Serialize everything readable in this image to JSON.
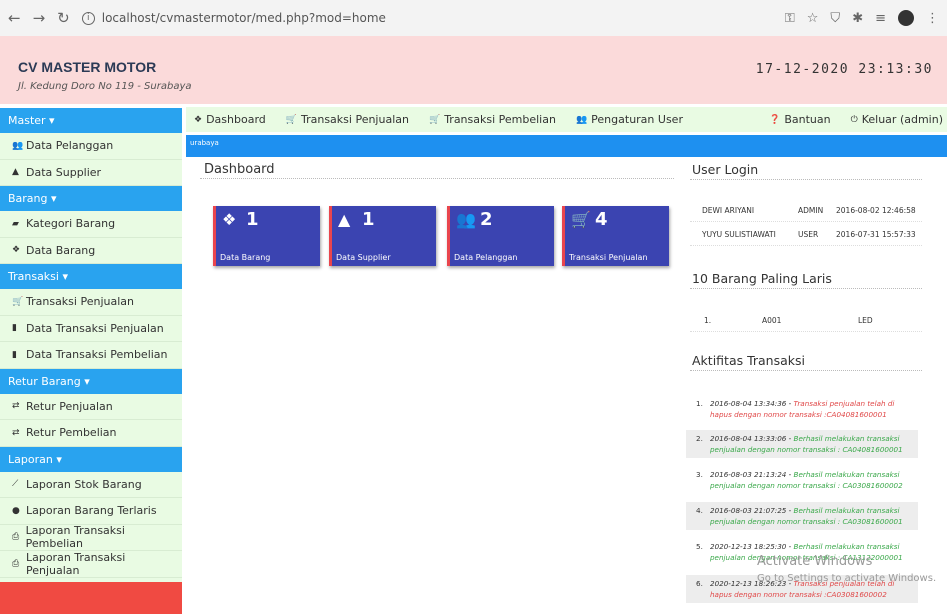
{
  "browser": {
    "url": "localhost/cvmastermotor/med.php?mod=home"
  },
  "header": {
    "brand_name": "CV MASTER MOTOR",
    "brand_address": "Jl. Kedung Doro No 119 - Surabaya",
    "datetime": "17-12-2020 23:13:30"
  },
  "sidebar": {
    "sections": [
      {
        "title": "Master ▾",
        "items": [
          {
            "label": "Data Pelanggan",
            "icon": "users-icon"
          },
          {
            "label": "Data Supplier",
            "icon": "user-icon"
          }
        ]
      },
      {
        "title": "Barang ▾",
        "items": [
          {
            "label": "Kategori Barang",
            "icon": "folder-icon"
          },
          {
            "label": "Data Barang",
            "icon": "cubes-icon"
          }
        ]
      },
      {
        "title": "Transaksi ▾",
        "items": [
          {
            "label": "Transaksi Penjualan",
            "icon": "cart-icon"
          },
          {
            "label": "Data Transaksi Penjualan",
            "icon": "book-icon"
          },
          {
            "label": "Data Transaksi Pembelian",
            "icon": "book-icon"
          }
        ]
      },
      {
        "title": "Retur Barang ▾",
        "items": [
          {
            "label": "Retur Penjualan",
            "icon": "return-cart-icon"
          },
          {
            "label": "Retur Pembelian",
            "icon": "return-cart-icon"
          }
        ]
      },
      {
        "title": "Laporan ▾",
        "items": [
          {
            "label": "Laporan Stok Barang",
            "icon": "chart-icon"
          },
          {
            "label": "Laporan Barang Terlaris",
            "icon": "star-icon"
          },
          {
            "label": "Laporan Transaksi Pembelian",
            "icon": "print-icon"
          },
          {
            "label": "Laporan Transaksi Penjualan",
            "icon": "print-icon"
          }
        ]
      }
    ]
  },
  "topmenu": {
    "dashboard": "Dashboard",
    "transaksi_penjualan": "Transaksi Penjualan",
    "transaksi_pembelian": "Transaksi Pembelian",
    "pengaturan_user": "Pengaturan User",
    "bantuan": "Bantuan",
    "keluar": "Keluar (admin)"
  },
  "breadcrumb": "urabaya",
  "main": {
    "title": "Dashboard",
    "boxes": [
      {
        "count": "1",
        "label": "Data Barang",
        "icon": "cubes-icon"
      },
      {
        "count": "1",
        "label": "Data Supplier",
        "icon": "user-icon"
      },
      {
        "count": "2",
        "label": "Data Pelanggan",
        "icon": "users-icon"
      },
      {
        "count": "4",
        "label": "Transaksi Penjualan",
        "icon": "cart-icon"
      }
    ]
  },
  "user_login": {
    "title": "User Login",
    "rows": [
      {
        "name": "DEWI ARIYANI",
        "role": "ADMIN",
        "time": "2016-08-02 12:46:58"
      },
      {
        "name": "YUYU SULISTIAWATI",
        "role": "USER",
        "time": "2016-07-31 15:57:33"
      }
    ]
  },
  "top_items": {
    "title": "10 Barang Paling Laris",
    "rows": [
      {
        "no": "1.",
        "code": "A001",
        "name": "LED"
      }
    ]
  },
  "activity": {
    "title": "Aktifitas Transaksi",
    "rows": [
      {
        "no": "1.",
        "time": "2016-08-04 13:34:36",
        "msg": "Transaksi penjualan telah di hapus dengan nomor transaksi :CA04081600001",
        "color": "#e04848"
      },
      {
        "no": "2.",
        "time": "2016-08-04 13:33:06",
        "msg": "Berhasil melakukan transaksi penjualan dengan nomor transaksi : CA04081600001",
        "color": "#3aa84a"
      },
      {
        "no": "3.",
        "time": "2016-08-03 21:13:24",
        "msg": "Berhasil melakukan transaksi penjualan dengan nomor transaksi : CA03081600002",
        "color": "#3aa84a"
      },
      {
        "no": "4.",
        "time": "2016-08-03 21:07:25",
        "msg": "Berhasil melakukan transaksi penjualan dengan nomor transaksi : CA03081600001",
        "color": "#3aa84a"
      },
      {
        "no": "5.",
        "time": "2020-12-13 18:25:30",
        "msg": "Berhasil melakukan transaksi penjualan dengan nomor transaksi : CA13122000001",
        "color": "#3aa84a"
      },
      {
        "no": "6.",
        "time": "2020-12-13 18:26:23",
        "msg": "Transaksi penjualan telah di hapus dengan nomor transaksi :CA03081600002",
        "color": "#e04848"
      }
    ]
  },
  "windows_watermark": {
    "line1": "Activate Windows",
    "line2": "Go to Settings to activate Windows."
  }
}
